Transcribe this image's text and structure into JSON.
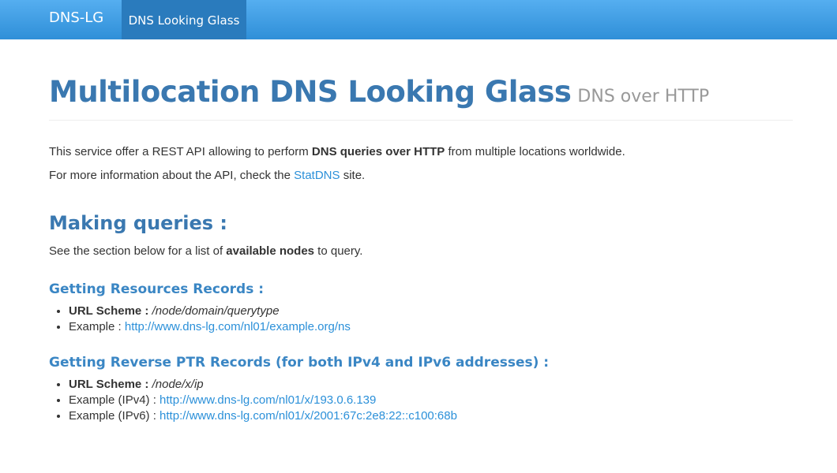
{
  "nav": {
    "brand": "DNS-LG",
    "active_item": "DNS Looking Glass"
  },
  "header": {
    "title": "Multilocation DNS Looking Glass",
    "subtitle": "DNS over HTTP"
  },
  "intro": {
    "p1_pre": "This service offer a REST API allowing to perform ",
    "p1_bold": "DNS queries over HTTP",
    "p1_post": " from multiple locations worldwide.",
    "p2_pre": "For more information about the API, check the ",
    "p2_link": "StatDNS",
    "p2_post": " site."
  },
  "queries": {
    "heading": "Making queries :",
    "desc_pre": "See the section below for a list of ",
    "desc_bold": "available nodes",
    "desc_post": " to query.",
    "resources": {
      "heading": "Getting Resources Records :",
      "scheme_label": "URL Scheme :",
      "scheme_value": "/node/domain/querytype",
      "example_label": "Example : ",
      "example_link": "http://www.dns-lg.com/nl01/example.org/ns"
    },
    "reverse": {
      "heading": "Getting Reverse PTR Records (for both IPv4 and IPv6 addresses) :",
      "scheme_label": "URL Scheme :",
      "scheme_value": "/node/x/ip",
      "ipv4_label": "Example (IPv4) : ",
      "ipv4_link": "http://www.dns-lg.com/nl01/x/193.0.6.139",
      "ipv6_label": "Example (IPv6) : ",
      "ipv6_link": "http://www.dns-lg.com/nl01/x/2001:67c:2e8:22::c100:68b"
    }
  }
}
